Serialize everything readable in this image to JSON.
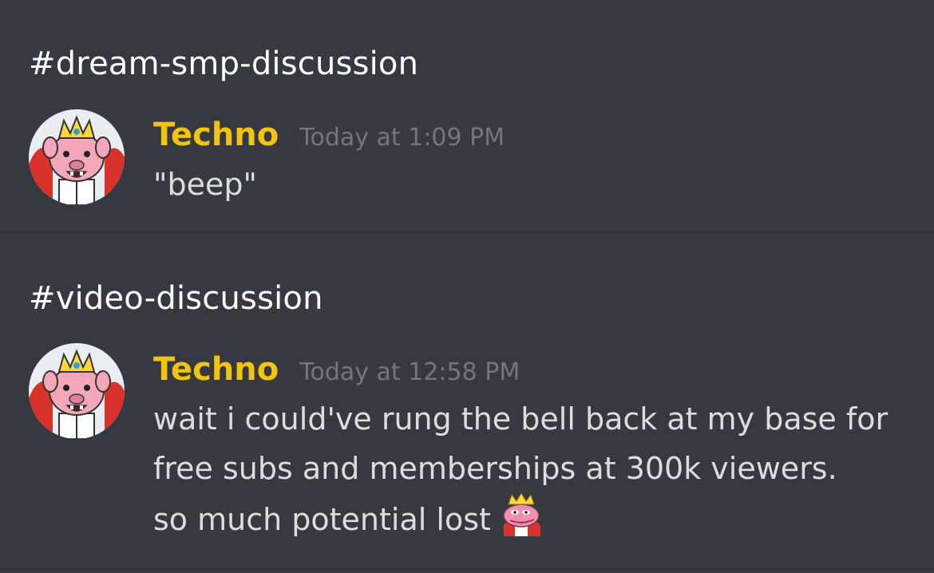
{
  "messages": [
    {
      "channel": "#dream-smp-discussion",
      "author": "Techno",
      "timestamp": "Today at 1:09 PM",
      "text_lines": [
        "\"beep\""
      ],
      "avatar_icon": "pig-king-avatar-icon"
    },
    {
      "channel": "#video-discussion",
      "author": "Techno",
      "timestamp": "Today at 12:58 PM",
      "text_lines": [
        "wait i could've rung the bell back at my base for",
        "free subs and memberships at 300k viewers.",
        "so much potential lost"
      ],
      "avatar_icon": "pig-king-avatar-icon",
      "emote_icon": "pig-king-pepe-emote-icon"
    }
  ],
  "colors": {
    "background": "#36393f",
    "divider": "#2f3136",
    "author": "#f1c40f",
    "timestamp": "#72767d",
    "message_text": "#dcddde",
    "channel_title": "#ffffff"
  }
}
